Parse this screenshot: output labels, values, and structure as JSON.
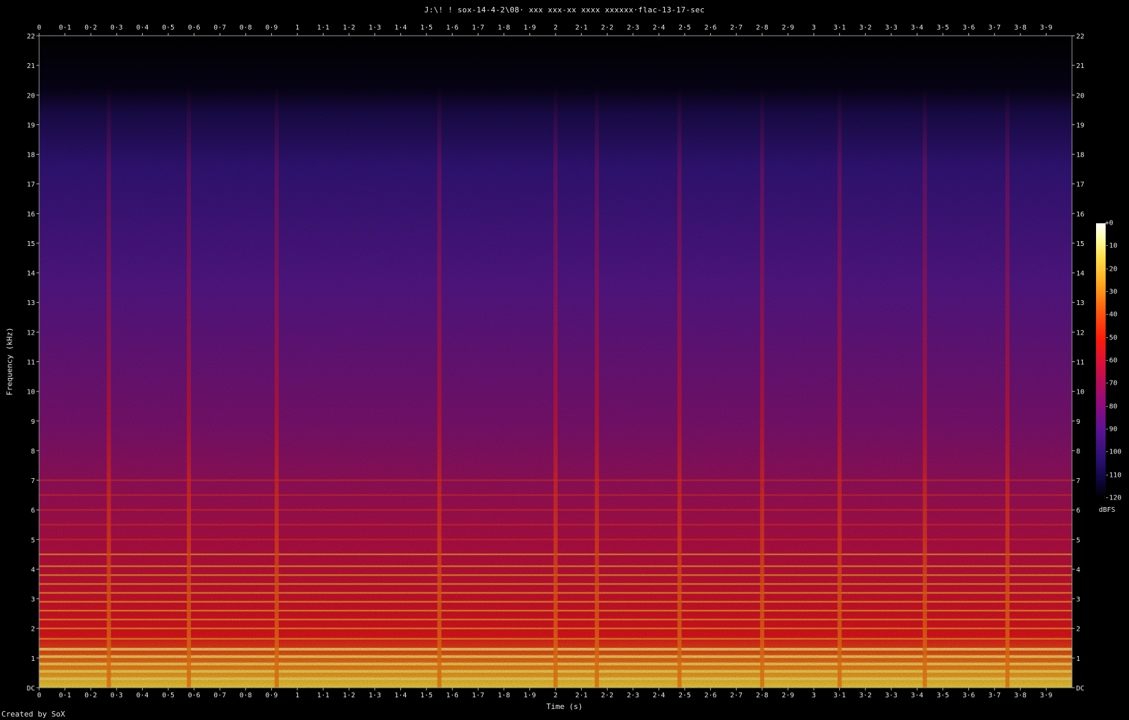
{
  "title": "J:\\! ! sox-14-4-2\\08· xxx xxx-xx xxxx xxxxxx·flac-13-17-sec",
  "credit": "Created by SoX",
  "chart_data": {
    "type": "heatmap",
    "title": "J:\\! ! sox-14-4-2\\08· xxx xxx-xx xxxx xxxxxx·flac-13-17-sec",
    "xlabel": "Time (s)",
    "ylabel": "Frequency (kHz)",
    "x_ticks": [
      "0",
      "0·1",
      "0·2",
      "0·3",
      "0·4",
      "0·5",
      "0·6",
      "0·7",
      "0·8",
      "0·9",
      "1",
      "1·1",
      "1·2",
      "1·3",
      "1·4",
      "1·5",
      "1·6",
      "1·7",
      "1·8",
      "1·9",
      "2",
      "2·1",
      "2·2",
      "2·3",
      "2·4",
      "2·5",
      "2·6",
      "2·7",
      "2·8",
      "2·9",
      "3",
      "3·1",
      "3·2",
      "3·3",
      "3·4",
      "3·5",
      "3·6",
      "3·7",
      "3·8",
      "3·9"
    ],
    "y_ticks": [
      "DC",
      "1",
      "2",
      "3",
      "4",
      "5",
      "6",
      "7",
      "8",
      "9",
      "10",
      "11",
      "12",
      "13",
      "14",
      "15",
      "16",
      "17",
      "18",
      "19",
      "20",
      "21",
      "22"
    ],
    "xlim": [
      0,
      4
    ],
    "ylim": [
      0,
      22
    ],
    "colorbar": {
      "unit": "dBFS",
      "ticks": [
        "+0",
        "-10",
        "-20",
        "-30",
        "-40",
        "-50",
        "-60",
        "-70",
        "-80",
        "-90",
        "-100",
        "-110",
        "-120"
      ],
      "range": [
        -120,
        0
      ]
    },
    "onsets_s": [
      0.27,
      0.58,
      0.92,
      1.55,
      2.0,
      2.16,
      2.48,
      2.8,
      3.1,
      3.43,
      3.75
    ],
    "harmonic_bands_khz": [
      0.3,
      0.55,
      0.8,
      1.05,
      1.3,
      1.65,
      2.0,
      2.3,
      2.6,
      2.9,
      3.2,
      3.5,
      3.8,
      4.1,
      4.5,
      5.0,
      5.5,
      6.0,
      6.5,
      7.0
    ],
    "noise_ceiling_khz": 20.4
  }
}
